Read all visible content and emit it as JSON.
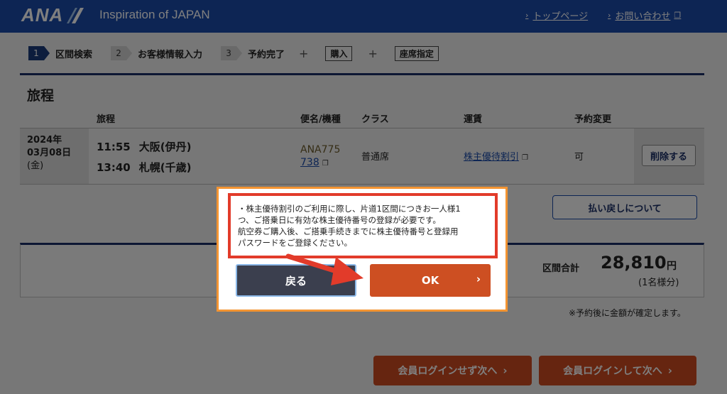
{
  "header": {
    "logo": "ANA",
    "tagline": "Inspiration of JAPAN",
    "links": [
      {
        "label": "トップページ"
      },
      {
        "label": "お問い合わせ"
      }
    ],
    "color": "#1b4aa9"
  },
  "steps": {
    "items": [
      {
        "num": "1",
        "label": "区間検索",
        "active": true
      },
      {
        "num": "2",
        "label": "お客様情報入力",
        "active": false
      },
      {
        "num": "3",
        "label": "予約完了",
        "active": false
      }
    ],
    "plus": "+",
    "extras": [
      "購入",
      "座席指定"
    ]
  },
  "itinerary": {
    "title": "旅程",
    "columns": {
      "route": "旅程",
      "flight": "便名/機種",
      "class": "クラス",
      "fare": "運賃",
      "change": "予約変更"
    },
    "row": {
      "date_year": "2024年",
      "date_day": "03月08日",
      "date_dow": "(金)",
      "dep_time": "11:55",
      "dep_airport": "大阪(伊丹)",
      "arr_time": "13:40",
      "arr_airport": "札幌(千歳)",
      "flight_no": "ANA775",
      "aircraft": "738",
      "seat_class": "普通席",
      "fare": "株主優待割引",
      "changeable": "可",
      "delete_label": "削除する"
    },
    "refund_label": "払い戻しについて"
  },
  "total": {
    "label": "区間合計",
    "amount": "28,810",
    "unit": "円",
    "per_person": "(1名様分)",
    "note": "※予約後に金額が確定します。"
  },
  "actions": {
    "next_guest": "会員ログインせず次へ",
    "next_login": "会員ログインして次へ"
  },
  "modal": {
    "message_lines": [
      "・株主優待割引のご利用に際し、片道1区間につきお一人様1",
      "つ、ご搭乗日に有効な株主優待番号の登録が必要です。",
      "航空券ご購入後、ご搭乗手続きまでに株主優待番号と登録用",
      "パスワードをご登録ください。"
    ],
    "back_label": "戻る",
    "ok_label": "OK",
    "highlight_color": "#e23b2a",
    "frame_color": "#f39432"
  }
}
